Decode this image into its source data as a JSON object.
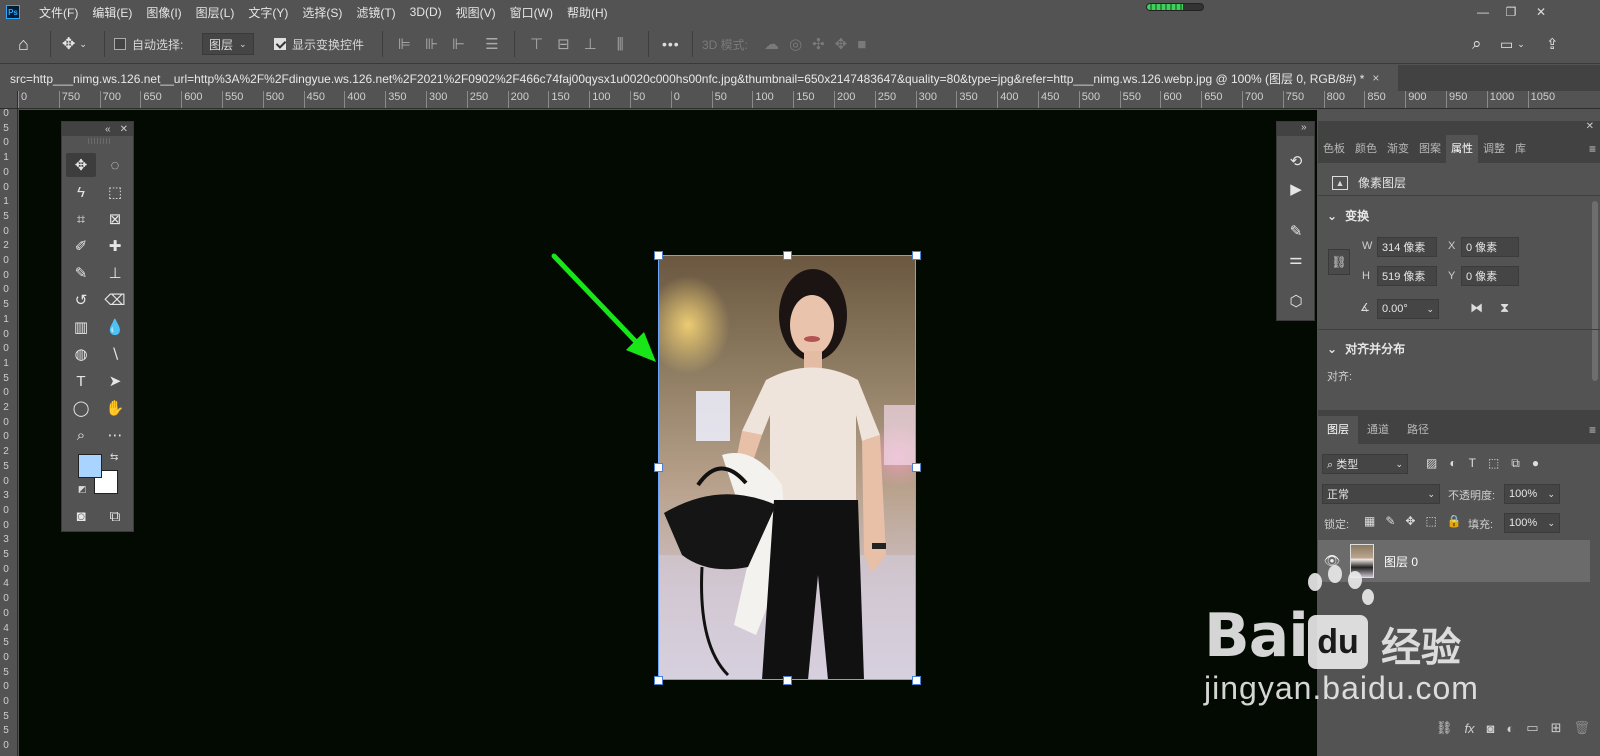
{
  "menubar": {
    "logo": "Ps",
    "items": [
      "文件(F)",
      "编辑(E)",
      "图像(I)",
      "图层(L)",
      "文字(Y)",
      "选择(S)",
      "滤镜(T)",
      "3D(D)",
      "视图(V)",
      "窗口(W)",
      "帮助(H)"
    ],
    "progress": 0.65
  },
  "optbar": {
    "auto_select_label": "自动选择:",
    "auto_select_target": "图层",
    "show_transform_label": "显示变换控件",
    "mode_3d_label": "3D 模式:",
    "more": "•••"
  },
  "document": {
    "tab_title": "src=http___nimg.ws.126.net__url=http%3A%2F%2Fdingyue.ws.126.net%2F2021%2F0902%2F466c74faj00qysx1u0020c000hs00nfc.jpg&thumbnail=650x2147483647&quality=80&type=jpg&refer=http___nimg.ws.126.webp.jpg @ 100% (图层 0, RGB/8#) *",
    "close": "×"
  },
  "ruler_h": [
    "0",
    "750",
    "700",
    "650",
    "600",
    "550",
    "500",
    "450",
    "400",
    "350",
    "300",
    "250",
    "200",
    "150",
    "100",
    "50",
    "0",
    "50",
    "100",
    "150",
    "200",
    "250",
    "300",
    "350",
    "400",
    "450",
    "500",
    "550",
    "600",
    "650",
    "700",
    "750",
    "800",
    "850",
    "900",
    "950",
    "1000",
    "1050"
  ],
  "ruler_v": [
    "0",
    "5",
    "0",
    "1",
    "0",
    "0",
    "1",
    "5",
    "0",
    "2",
    "0",
    "0",
    "0",
    "5",
    "1",
    "0",
    "0",
    "1",
    "5",
    "0",
    "2",
    "0",
    "0",
    "2",
    "5",
    "0",
    "3",
    "0",
    "0",
    "3",
    "5",
    "0",
    "4",
    "0",
    "0",
    "4",
    "5",
    "0",
    "5",
    "0",
    "0",
    "5",
    "5",
    "0"
  ],
  "properties": {
    "tabs": [
      "色板",
      "颜色",
      "渐变",
      "图案",
      "属性",
      "调整",
      "库"
    ],
    "active_tab": "属性",
    "layer_kind": "像素图层",
    "transform_title": "变换",
    "w_label": "W",
    "w_value": "314 像素",
    "h_label": "H",
    "h_value": "519 像素",
    "x_label": "X",
    "x_value": "0 像素",
    "y_label": "Y",
    "y_value": "0 像素",
    "angle_value": "0.00°",
    "align_title": "对齐并分布",
    "align_label": "对齐:"
  },
  "layers": {
    "tabs": [
      "图层",
      "通道",
      "路径"
    ],
    "filter_kind": "类型",
    "blend_mode": "正常",
    "opacity_label": "不透明度:",
    "opacity_value": "100%",
    "lock_label": "锁定:",
    "fill_label": "填充:",
    "fill_value": "100%",
    "items": [
      {
        "name": "图层 0",
        "visible": true
      }
    ],
    "bottom_fx": "fx"
  },
  "watermark": {
    "brand": "Bai",
    "du": "du",
    "jingyan": "经验",
    "url": "jingyan.baidu.com"
  },
  "colors": {
    "foreground": "#a8d4ff",
    "background": "#ffffff",
    "arrow": "#19e619",
    "selection": "#6aa6ff"
  }
}
